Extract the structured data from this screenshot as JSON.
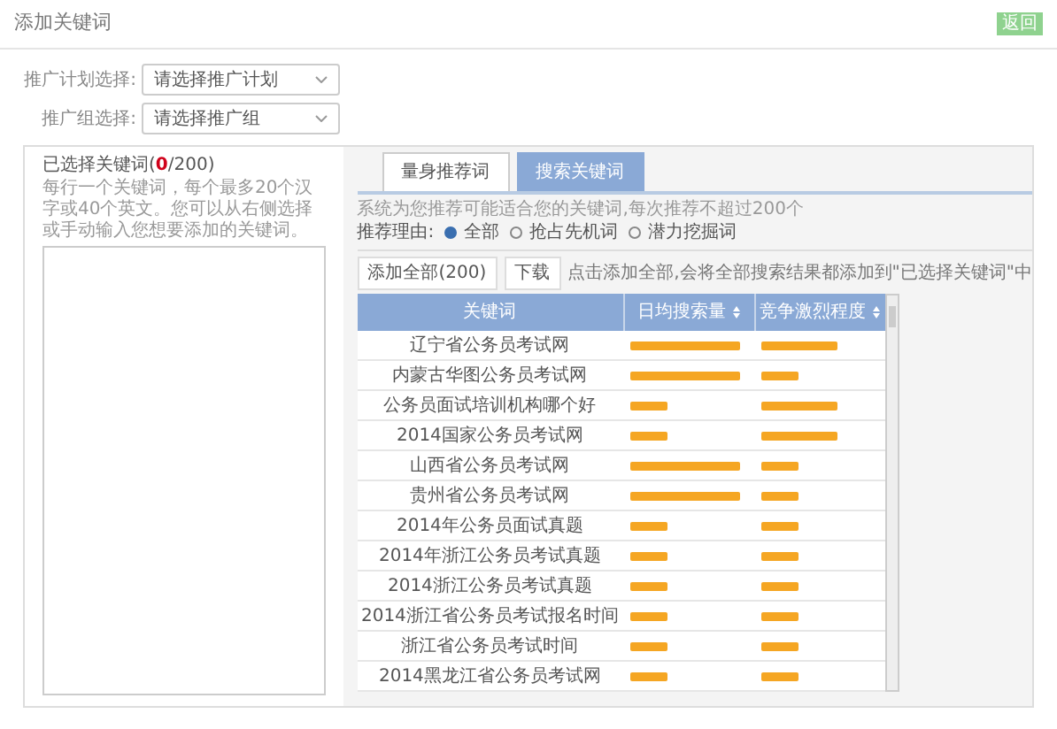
{
  "dialog": {
    "title": "添加关键词",
    "back_button": "返回"
  },
  "form": [
    {
      "label": "推广计划选择:",
      "placeholder": "请选择推广计划"
    },
    {
      "label": "推广组选择:",
      "placeholder": "请选择推广组"
    }
  ],
  "selected_panel": {
    "title_prefix": "已选择关键词(",
    "count": "0",
    "title_suffix": "/200)",
    "hint": "每行一个关键词，每个最多20个汉字或40个英文。您可以从右侧选择或手动输入您想要添加的关键词。"
  },
  "tabs": [
    {
      "label": "量身推荐词",
      "selected": true
    },
    {
      "label": "搜索关键词",
      "selected": false
    }
  ],
  "description": "系统为您推荐可能适合您的关键词,每次推荐不超过200个",
  "reason": {
    "label": "推荐理由:",
    "options": [
      {
        "label": "全部",
        "selected": true
      },
      {
        "label": "抢占先机词",
        "selected": false
      },
      {
        "label": "潜力挖掘词",
        "selected": false
      }
    ]
  },
  "actions": {
    "add_all": "添加全部(200)",
    "download": "下载",
    "note": "点击添加全部,会将全部搜索结果都添加到\"已选择关键词\"中"
  },
  "table": {
    "columns": [
      "关键词",
      "日均搜索量",
      "竞争激烈程度"
    ],
    "rows": [
      {
        "keyword": "辽宁省公务员考试网",
        "search": {
          "level": 0.95
        },
        "competition": {
          "level": 0.65
        }
      },
      {
        "keyword": "内蒙古华图公务员考试网",
        "search": {
          "level": 0.95
        },
        "competition": {
          "level": 0.33
        }
      },
      {
        "keyword": "公务员面试培训机构哪个好",
        "search": {
          "level": 0.33
        },
        "competition": {
          "level": 0.65
        }
      },
      {
        "keyword": "2014国家公务员考试网",
        "search": {
          "level": 0.33
        },
        "competition": {
          "level": 0.65
        }
      },
      {
        "keyword": "山西省公务员考试网",
        "search": {
          "level": 0.95
        },
        "competition": {
          "level": 0.33
        }
      },
      {
        "keyword": "贵州省公务员考试网",
        "search": {
          "level": 0.95
        },
        "competition": {
          "level": 0.33
        }
      },
      {
        "keyword": "2014年公务员面试真题",
        "search": {
          "level": 0.33
        },
        "competition": {
          "level": 0.33
        }
      },
      {
        "keyword": "2014年浙江公务员考试真题",
        "search": {
          "level": 0.33
        },
        "competition": {
          "level": 0.33
        }
      },
      {
        "keyword": "2014浙江公务员考试真题",
        "search": {
          "level": 0.33
        },
        "competition": {
          "level": 0.33
        }
      },
      {
        "keyword": "2014浙江省公务员考试报名时间",
        "search": {
          "level": 0.33
        },
        "competition": {
          "level": 0.33
        }
      },
      {
        "keyword": "浙江省公务员考试时间",
        "search": {
          "level": 0.33
        },
        "competition": {
          "level": 0.33
        }
      },
      {
        "keyword": "2014黑龙江省公务员考试网",
        "search": {
          "level": 0.33
        },
        "competition": {
          "level": 0.33
        }
      }
    ]
  }
}
